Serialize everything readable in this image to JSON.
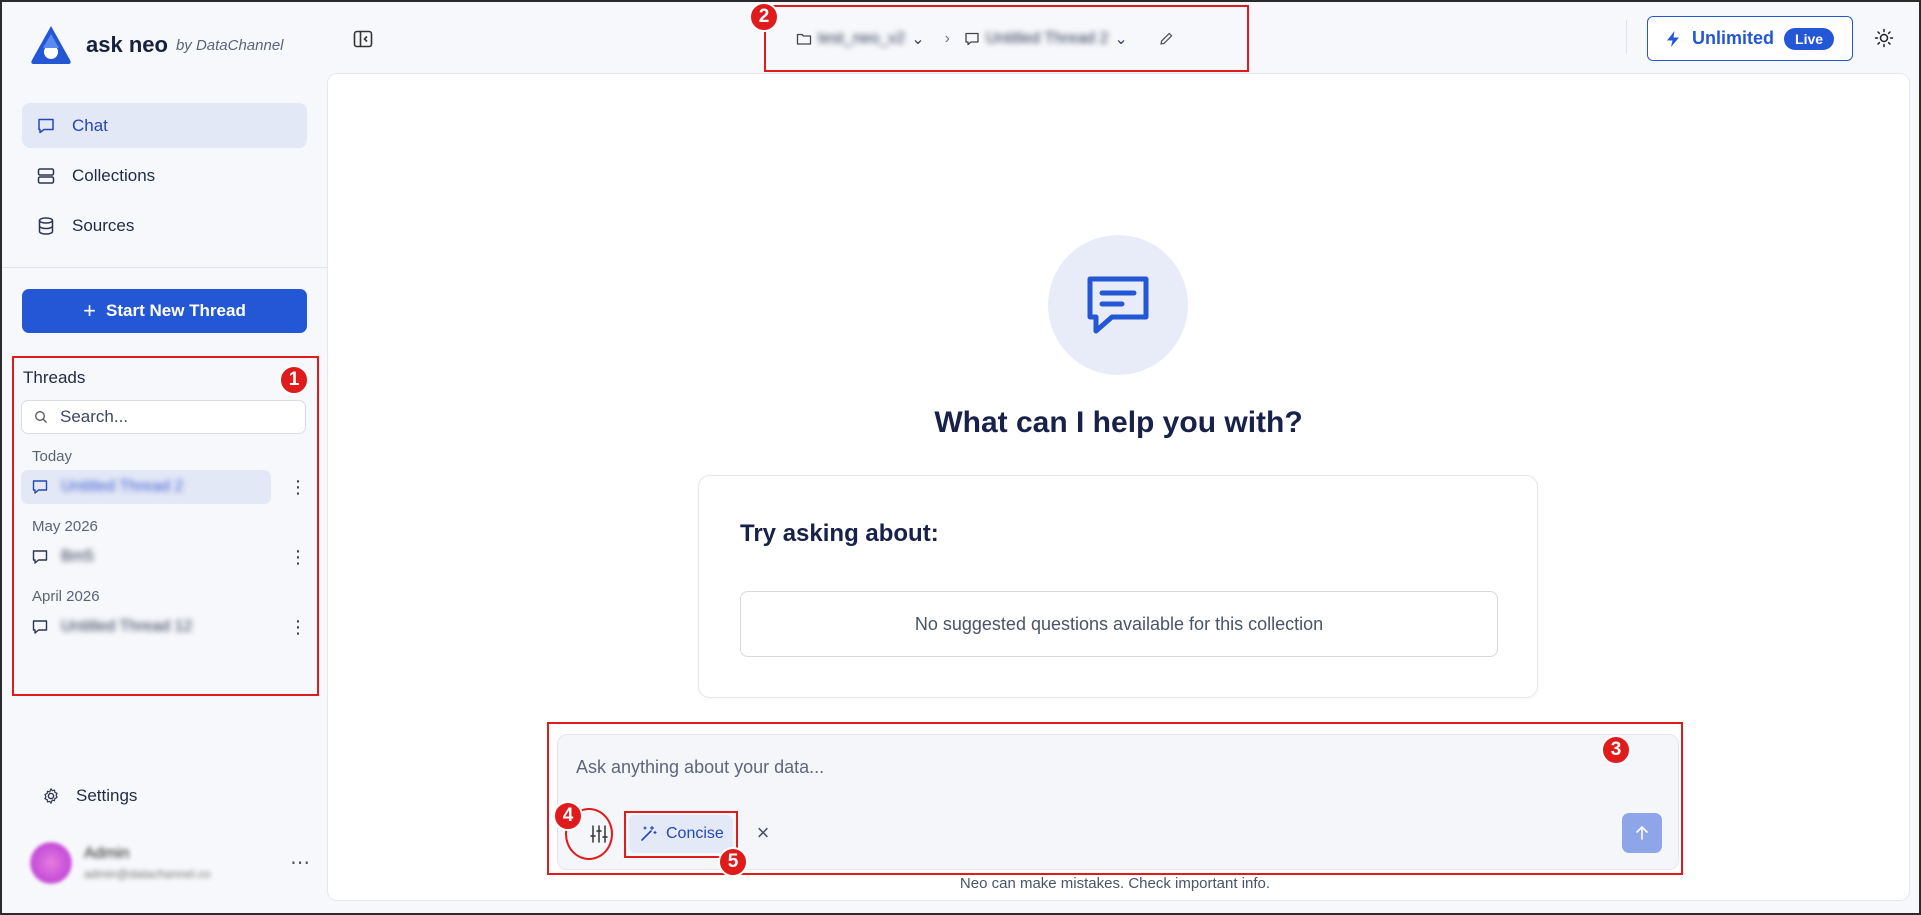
{
  "brand": {
    "name": "ask neo",
    "by": "by DataChannel"
  },
  "nav": [
    {
      "label": "Chat",
      "icon": "chat-icon",
      "active": true
    },
    {
      "label": "Collections",
      "icon": "collections-icon",
      "active": false
    },
    {
      "label": "Sources",
      "icon": "database-icon",
      "active": false
    }
  ],
  "new_thread_label": "Start New Thread",
  "threads": {
    "title": "Threads",
    "search_placeholder": "Search...",
    "groups": [
      {
        "label": "Today",
        "items": [
          {
            "title": "Untitled Thread 2",
            "active": true
          }
        ]
      },
      {
        "label": "May 2026",
        "items": [
          {
            "title": "Bm5",
            "active": false
          }
        ]
      },
      {
        "label": "April 2026",
        "items": [
          {
            "title": "Untitled Thread 12",
            "active": false
          }
        ]
      }
    ]
  },
  "settings_label": "Settings",
  "user": {
    "name": "Admin",
    "email": "admin@datachannel.co"
  },
  "breadcrumb": {
    "collection": "test_neo_v2",
    "thread": "Untitled Thread 2"
  },
  "plan": {
    "label": "Unlimited",
    "badge": "Live",
    "accent": "#2457d6"
  },
  "main": {
    "headline": "What can I help you with?",
    "suggestions_title": "Try asking about:",
    "suggestions_empty": "No suggested questions available for this collection"
  },
  "composer": {
    "placeholder": "Ask anything about your data...",
    "mode_label": "Concise",
    "disclaimer": "Neo can make mistakes. Check important info."
  },
  "annotations": [
    "1",
    "2",
    "3",
    "4",
    "5"
  ]
}
